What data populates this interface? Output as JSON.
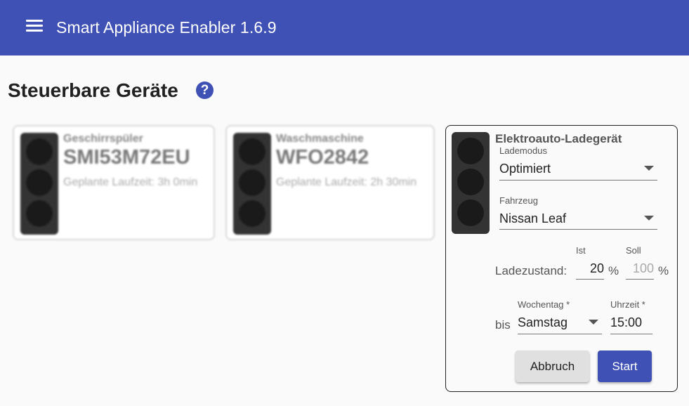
{
  "toolbar": {
    "title": "Smart Appliance Enabler 1.6.9",
    "menu_icon": "hamburger-menu-icon",
    "color": "#3f51b5"
  },
  "page": {
    "title": "Steuerbare Geräte",
    "help_icon": "?"
  },
  "cards": [
    {
      "type": "Geschirrspüler",
      "name": "SMI53M72EU",
      "runtime": "Geplante Laufzeit: 3h 0min"
    },
    {
      "type": "Waschmaschine",
      "name": "WFO2842",
      "runtime": "Geplante Laufzeit: 2h 30min"
    }
  ],
  "ev_card": {
    "title": "Elektroauto-Ladegerät",
    "mode_label": "Lademodus",
    "mode_value": "Optimiert",
    "vehicle_label": "Fahrzeug",
    "vehicle_value": "Nissan Leaf",
    "soc_label": "Ladezustand:",
    "soc_actual_label": "Ist",
    "soc_actual_value": "20",
    "soc_target_label": "Soll",
    "soc_target_placeholder": "100",
    "percent": "%",
    "until_label": "bis",
    "weekday_label": "Wochentag *",
    "weekday_value": "Samstag",
    "time_label": "Uhrzeit *",
    "time_value": "15:00",
    "cancel_label": "Abbruch",
    "start_label": "Start"
  }
}
